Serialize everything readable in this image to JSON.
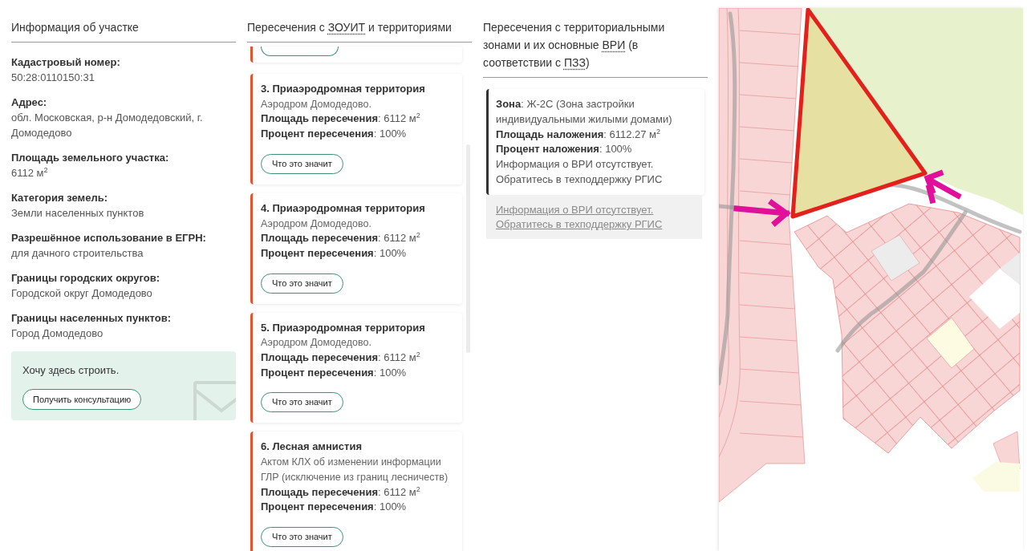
{
  "plot_info": {
    "heading": [
      {
        "text": "Информация об участке",
        "abbr": false
      }
    ],
    "fields": [
      {
        "label": "Кадастровый номер:",
        "value": "50:28:0110150:31"
      },
      {
        "label": "Адрес:",
        "value": "обл. Московская, р-н Домодедовский, г. Домодедово"
      },
      {
        "label": "Площадь земельного участка:",
        "value": "6112 м$^{2}$"
      },
      {
        "label": "Категория земель:",
        "value": "Земли населенных пунктов"
      },
      {
        "label": "Разрешённое использование в ЕГРН:",
        "value": "для дачного строительства"
      },
      {
        "label": "Границы городских округов:",
        "value": "Городской округ Домодедово"
      },
      {
        "label": "Границы населенных пунктов:",
        "value": "Город Домодедово"
      }
    ],
    "promo": {
      "text": "Хочу здесь строить.",
      "button": "Получить консультацию"
    }
  },
  "zouit": {
    "heading": [
      {
        "text": "Пересечения с ",
        "abbr": false
      },
      {
        "text": "ЗОУИТ",
        "abbr": true
      },
      {
        "text": " и территориями",
        "abbr": false
      }
    ],
    "cards": [
      {
        "kind": "clipped"
      },
      {
        "kind": "full",
        "title": "3. Приаэродромная территория",
        "description": "Аэродром Домодедово.",
        "lines": [
          "**Площадь пересечения**: 6112 м$^{2}$",
          "**Процент пересечения**: 100%"
        ],
        "button": "Что это значит"
      },
      {
        "kind": "full",
        "title": "4. Приаэродромная территория",
        "description": "Аэродром Домодедово.",
        "lines": [
          "**Площадь пересечения**: 6112 м$^{2}$",
          "**Процент пересечения**: 100%"
        ],
        "button": "Что это значит"
      },
      {
        "kind": "full",
        "title": "5. Приаэродромная территория",
        "description": "Аэродром Домодедово.",
        "lines": [
          "**Площадь пересечения**: 6112 м$^{2}$",
          "**Процент пересечения**: 100%"
        ],
        "button": "Что это значит"
      },
      {
        "kind": "full",
        "title": "6. Лесная амнистия",
        "description": "Актом КЛХ об изменении информации ГЛР (исключение из границ лесничеств)",
        "lines": [
          "**Площадь пересечения**: 6112 м$^{2}$",
          "**Процент пересечения**: 100%"
        ],
        "button": "Что это значит"
      }
    ]
  },
  "zones": {
    "heading": [
      {
        "text": "Пересечения с территориальными зонами и их основные ",
        "abbr": false
      },
      {
        "text": "ВРИ",
        "abbr": true
      },
      {
        "text": " (в соответствии с ",
        "abbr": false
      },
      {
        "text": "ПЗЗ",
        "abbr": true
      },
      {
        "text": ")",
        "abbr": false
      }
    ],
    "cards": [
      {
        "lines": [
          "**Зона**: Ж-2С (Зона застройки индивидуальными жилыми домами)",
          "**Площадь наложения**: 6112.27 м$^{2}$",
          "**Процент наложения**: 100%",
          "Информация о ВРИ отсутствует. Обратитесь в техподдержку РГИС"
        ]
      }
    ],
    "note_link": "Информация о ВРИ отсутствует. Обратитесь в техподдержку РГИС"
  }
}
